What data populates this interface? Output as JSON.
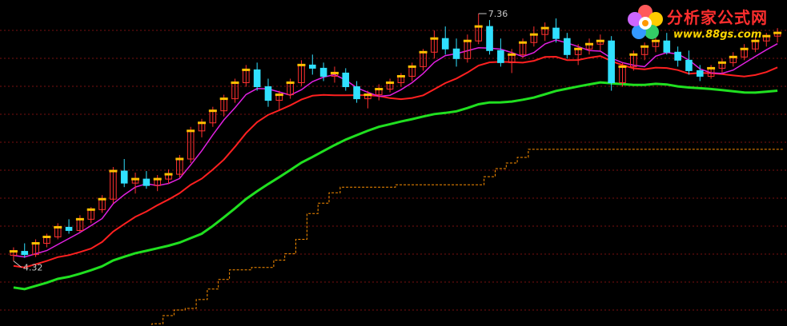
{
  "watermark": {
    "name": "分析家公式网",
    "url": "www.88gs.com"
  },
  "chart_data": {
    "type": "candlestick",
    "grid": "dotted horizontal, dark red",
    "colors": {
      "up": "#ff3030",
      "down": "#30e0ff",
      "ma_short": "#ff2020",
      "ma_long": "#20e020",
      "magenta_line": "#e020e0",
      "orange_marks": "#ffc000",
      "stop_line": "#ff9000",
      "blue_line": "#3050ff"
    },
    "price_labels": {
      "high": "7.36",
      "low": "4.32"
    },
    "range": [
      3.6,
      7.45
    ],
    "candles": [
      [
        4.35,
        4.45,
        4.28,
        4.4
      ],
      [
        4.4,
        4.5,
        4.32,
        4.36
      ],
      [
        4.36,
        4.55,
        4.33,
        4.5
      ],
      [
        4.5,
        4.62,
        4.45,
        4.58
      ],
      [
        4.58,
        4.75,
        4.55,
        4.7
      ],
      [
        4.7,
        4.8,
        4.62,
        4.66
      ],
      [
        4.66,
        4.85,
        4.64,
        4.8
      ],
      [
        4.8,
        4.95,
        4.75,
        4.92
      ],
      [
        4.92,
        5.1,
        4.88,
        5.05
      ],
      [
        5.05,
        5.45,
        5.0,
        5.4
      ],
      [
        5.4,
        5.55,
        5.2,
        5.25
      ],
      [
        5.25,
        5.38,
        5.12,
        5.3
      ],
      [
        5.3,
        5.4,
        5.18,
        5.22
      ],
      [
        5.22,
        5.35,
        5.15,
        5.3
      ],
      [
        5.3,
        5.42,
        5.24,
        5.36
      ],
      [
        5.36,
        5.6,
        5.32,
        5.55
      ],
      [
        5.55,
        5.95,
        5.5,
        5.9
      ],
      [
        5.9,
        6.05,
        5.82,
        6.0
      ],
      [
        6.0,
        6.2,
        5.95,
        6.15
      ],
      [
        6.15,
        6.35,
        6.08,
        6.3
      ],
      [
        6.3,
        6.55,
        6.25,
        6.5
      ],
      [
        6.5,
        6.72,
        6.45,
        6.66
      ],
      [
        6.66,
        6.75,
        6.4,
        6.45
      ],
      [
        6.45,
        6.55,
        6.2,
        6.28
      ],
      [
        6.28,
        6.4,
        6.15,
        6.35
      ],
      [
        6.35,
        6.55,
        6.3,
        6.5
      ],
      [
        6.5,
        6.78,
        6.46,
        6.72
      ],
      [
        6.72,
        6.85,
        6.6,
        6.68
      ],
      [
        6.68,
        6.75,
        6.52,
        6.58
      ],
      [
        6.58,
        6.7,
        6.5,
        6.62
      ],
      [
        6.62,
        6.68,
        6.4,
        6.45
      ],
      [
        6.45,
        6.52,
        6.25,
        6.3
      ],
      [
        6.3,
        6.4,
        6.18,
        6.35
      ],
      [
        6.35,
        6.48,
        6.28,
        6.42
      ],
      [
        6.42,
        6.55,
        6.38,
        6.5
      ],
      [
        6.5,
        6.62,
        6.45,
        6.58
      ],
      [
        6.58,
        6.75,
        6.52,
        6.7
      ],
      [
        6.7,
        6.92,
        6.65,
        6.88
      ],
      [
        6.88,
        7.15,
        6.8,
        7.05
      ],
      [
        7.05,
        7.2,
        6.85,
        6.92
      ],
      [
        6.92,
        7.05,
        6.7,
        6.8
      ],
      [
        6.8,
        7.1,
        6.75,
        7.02
      ],
      [
        7.02,
        7.36,
        6.98,
        7.2
      ],
      [
        7.2,
        7.28,
        6.85,
        6.9
      ],
      [
        6.9,
        7.05,
        6.7,
        6.75
      ],
      [
        6.75,
        6.92,
        6.62,
        6.85
      ],
      [
        6.85,
        7.05,
        6.8,
        7.0
      ],
      [
        7.0,
        7.2,
        6.95,
        7.1
      ],
      [
        7.1,
        7.25,
        7.02,
        7.18
      ],
      [
        7.18,
        7.3,
        7.0,
        7.05
      ],
      [
        7.05,
        7.12,
        6.8,
        6.85
      ],
      [
        6.85,
        6.98,
        6.72,
        6.92
      ],
      [
        6.92,
        7.05,
        6.85,
        6.98
      ],
      [
        6.98,
        7.1,
        6.9,
        7.02
      ],
      [
        7.02,
        7.08,
        6.4,
        6.5
      ],
      [
        6.5,
        6.75,
        6.45,
        6.7
      ],
      [
        6.7,
        6.9,
        6.65,
        6.85
      ],
      [
        6.85,
        7.0,
        6.78,
        6.95
      ],
      [
        6.95,
        7.08,
        6.88,
        7.02
      ],
      [
        7.02,
        7.12,
        6.85,
        6.88
      ],
      [
        6.88,
        6.95,
        6.7,
        6.78
      ],
      [
        6.78,
        6.9,
        6.6,
        6.65
      ],
      [
        6.65,
        6.72,
        6.52,
        6.58
      ],
      [
        6.58,
        6.72,
        6.55,
        6.68
      ],
      [
        6.68,
        6.8,
        6.62,
        6.75
      ],
      [
        6.75,
        6.88,
        6.7,
        6.82
      ],
      [
        6.82,
        6.98,
        6.78,
        6.92
      ],
      [
        6.92,
        7.08,
        6.88,
        7.02
      ],
      [
        7.02,
        7.12,
        6.95,
        7.08
      ],
      [
        7.08,
        7.18,
        7.0,
        7.12
      ]
    ]
  }
}
